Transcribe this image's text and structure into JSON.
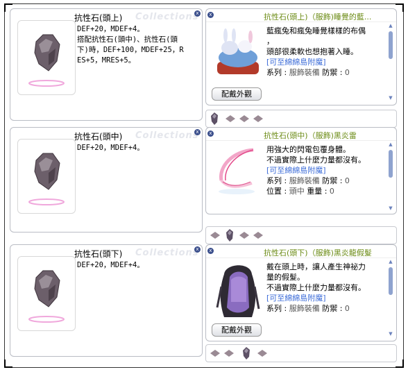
{
  "colors": {
    "title_green": "#6b8b14",
    "link_blue": "#3c6cd8",
    "frame": "#b9bcc4"
  },
  "watermark": "Collections",
  "close_icon": "x",
  "left_windows": [
    {
      "title": "抗性石(頭上)",
      "lines": [
        "DEF+20，MDEF+4。",
        "搭配抗性石(頭中)、抗性石(頭",
        "下)時，DEF+100，MDEF+25，R",
        "ES+5，MRES+5。"
      ]
    },
    {
      "title": "抗性石(頭中)",
      "lines": [
        "DEF+20，MDEF+4。"
      ]
    },
    {
      "title": "抗性石(頭下)",
      "lines": [
        "DEF+20，MDEF+4。"
      ]
    }
  ],
  "right_windows": [
    {
      "title": "抗性石(頭上)（服飾)睡覺的藍...",
      "lines": [
        "藍瘋兔和瘋兔睡覺樣樣的布偶",
        "，",
        "頭部很柔軟也想抱著入睡。"
      ],
      "link": "[可至綿綿島附魔]",
      "kv1": {
        "label": "系列 :",
        "value": "服飾裝備",
        "label2": "防禦 :",
        "value2": "0"
      },
      "button": "配戴外觀"
    },
    {
      "title": "抗性石(頭中)（服飾)黑炎雷",
      "lines": [
        "用強大的閃電包覆身體。",
        "不過實際上什麼力量都沒有。"
      ],
      "link": "[可至綿綿島附魔]",
      "kv1": {
        "label": "系列 :",
        "value": "服飾裝備",
        "label2": "防禦 :",
        "value2": "0"
      },
      "kv2": {
        "label": "位置 :",
        "value": "頭中",
        "label2": "重量 :",
        "value2": "0"
      }
    },
    {
      "title": "抗性石(頭下)（服飾)黑炎龍假髮",
      "lines": [
        "戴在頭上時，讓人產生神祕力",
        "量的假髮。",
        "不過實際上什麼力量都沒有。"
      ],
      "link": "[可至綿綿島附魔]",
      "kv1": {
        "label": "系列 :",
        "value": "服飾裝備",
        "label2": "防禦 :",
        "value2": "0"
      },
      "button": "配戴外觀"
    }
  ]
}
